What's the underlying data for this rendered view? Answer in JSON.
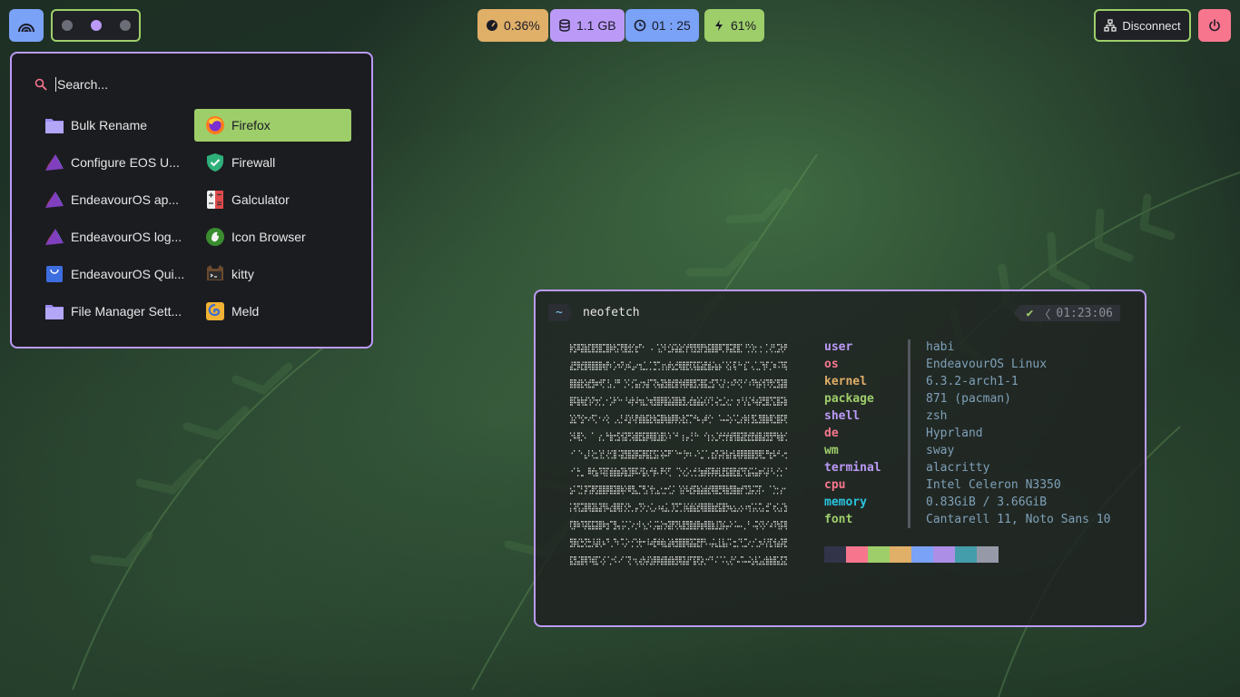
{
  "topbar": {
    "cpu": "0.36%",
    "memory": "1.1 GB",
    "uptime": "01 : 25",
    "battery": "61%",
    "disconnect_label": "Disconnect"
  },
  "launcher": {
    "search_placeholder": "Search...",
    "apps": [
      {
        "label": "Bulk Rename",
        "icon": "folder-icon"
      },
      {
        "label": "Configure EOS U...",
        "icon": "endeavouros-icon"
      },
      {
        "label": "EndeavourOS ap...",
        "icon": "endeavouros-icon"
      },
      {
        "label": "EndeavourOS log...",
        "icon": "endeavouros-icon"
      },
      {
        "label": "EndeavourOS Qui...",
        "icon": "shopping-bag-icon"
      },
      {
        "label": "File Manager Sett...",
        "icon": "folder-icon"
      },
      {
        "label": "Firefox",
        "icon": "firefox-icon"
      },
      {
        "label": "Firewall",
        "icon": "shield-check-icon"
      },
      {
        "label": "Galculator",
        "icon": "calculator-icon"
      },
      {
        "label": "Icon Browser",
        "icon": "gimp-icon"
      },
      {
        "label": "kitty",
        "icon": "kitty-icon"
      },
      {
        "label": "Meld",
        "icon": "meld-icon"
      }
    ]
  },
  "terminal": {
    "prompt_dir": "~",
    "command": "neofetch",
    "clock": "01:23:06",
    "info": [
      {
        "key": "user",
        "value": "habi",
        "color": "#bb9af7"
      },
      {
        "key": "os",
        "value": "EndeavourOS Linux",
        "color": "#f7768e"
      },
      {
        "key": "kernel",
        "value": "6.3.2-arch1-1",
        "color": "#e0af68"
      },
      {
        "key": "package",
        "value": "871 (pacman)",
        "color": "#9ece6a"
      },
      {
        "key": "shell",
        "value": "zsh",
        "color": "#bb9af7"
      },
      {
        "key": "de",
        "value": "Hyprland",
        "color": "#f7768e"
      },
      {
        "key": "wm",
        "value": "sway",
        "color": "#9ece6a"
      },
      {
        "key": "terminal",
        "value": "alacritty",
        "color": "#bb9af7"
      },
      {
        "key": "cpu",
        "value": "Intel Celeron N3350",
        "color": "#f7768e"
      },
      {
        "key": "memory",
        "value": "0.83GiB / 3.66GiB",
        "color": "#2ac3de"
      },
      {
        "key": "font",
        "value": "Cantarell 11, Noto Sans 10",
        "color": "#9ece6a"
      }
    ],
    "swatches": [
      "#32344a",
      "#f7768e",
      "#9ece6a",
      "#e0af68",
      "#7aa2f7",
      "#ad8ee6",
      "#449dab",
      "#9699a8"
    ]
  }
}
